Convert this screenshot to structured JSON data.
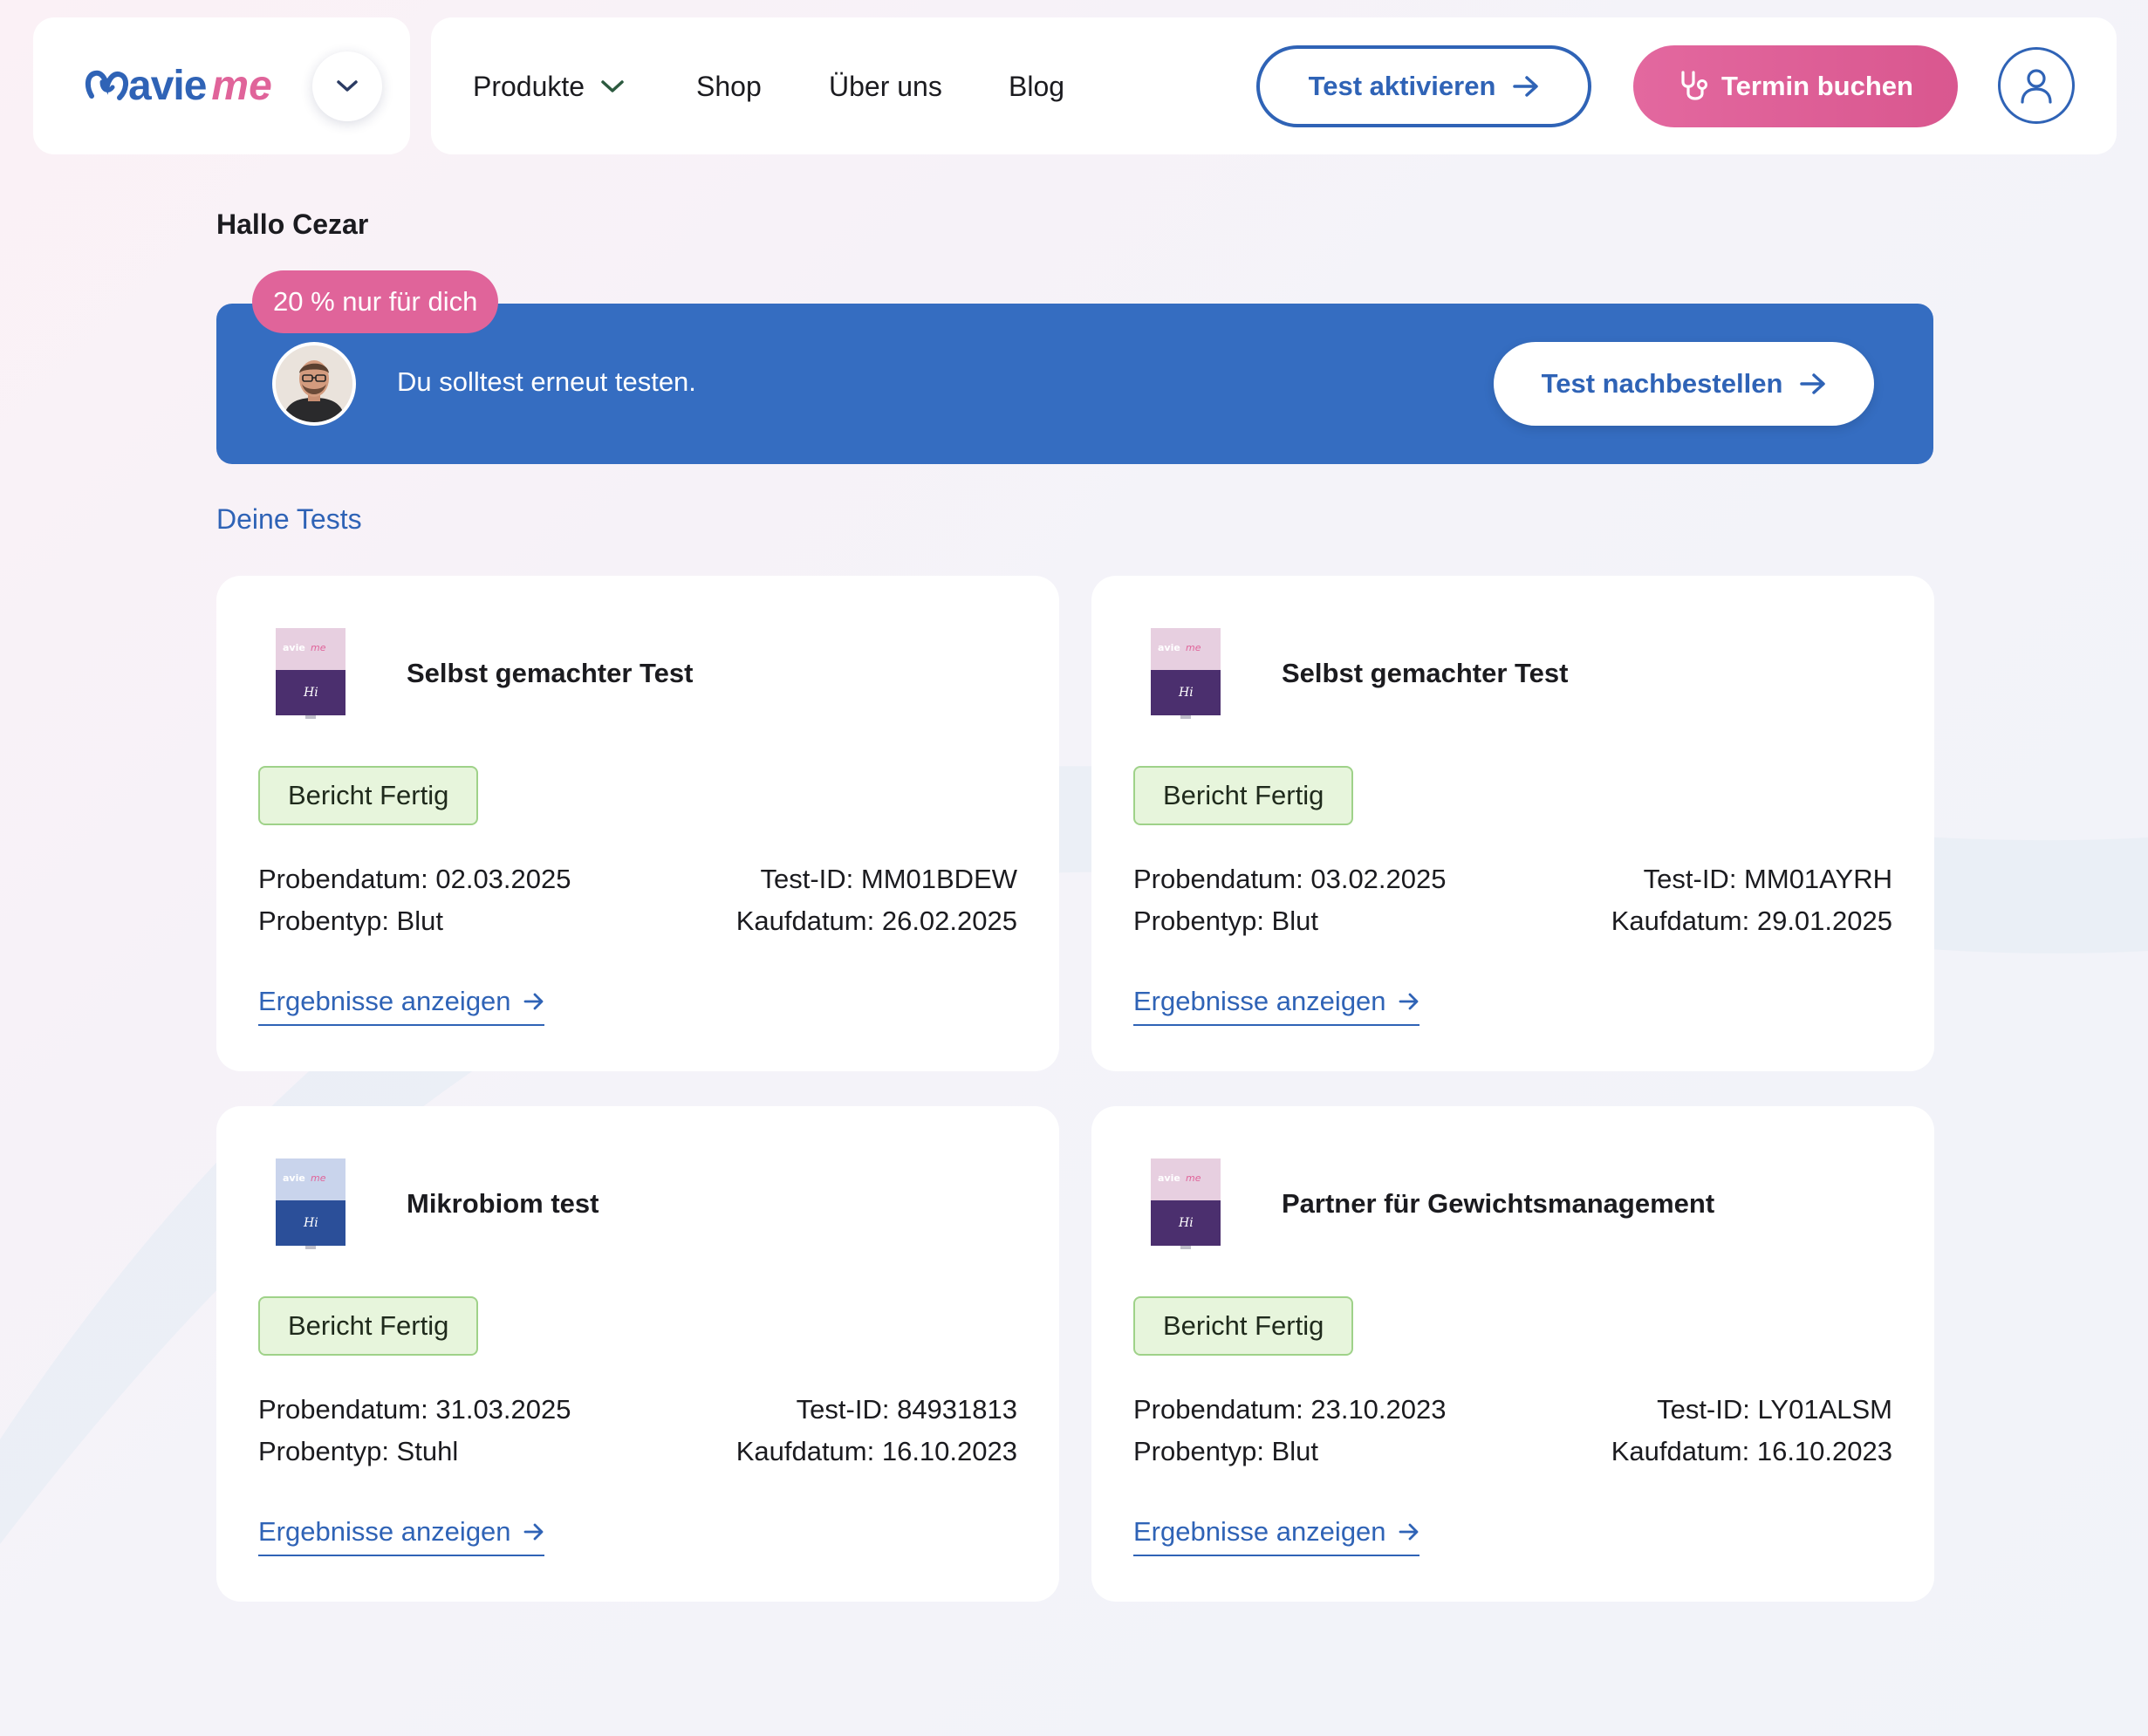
{
  "header": {
    "brand": {
      "part1": "avie",
      "part2": "me"
    },
    "nav": [
      {
        "label": "Produkte",
        "has_dropdown": true
      },
      {
        "label": "Shop"
      },
      {
        "label": "Über uns"
      },
      {
        "label": "Blog"
      }
    ],
    "activate_label": "Test aktivieren",
    "book_label": "Termin buchen"
  },
  "greeting": "Hallo Cezar",
  "promo": {
    "badge": "20 % nur für dich",
    "text": "Du solltest erneut testen.",
    "button_label": "Test nachbestellen"
  },
  "section_title": "Deine Tests",
  "tests": [
    {
      "title": "Selbst gemachter Test",
      "status": "Bericht Fertig",
      "sample_date": "Probendatum: 02.03.2025",
      "sample_type": "Probentyp: Blut",
      "test_id": "Test-ID: MM01BDEW",
      "purchase_date": "Kaufdatum: 26.02.2025",
      "link": "Ergebnisse anzeigen"
    },
    {
      "title": "Selbst gemachter Test",
      "status": "Bericht Fertig",
      "sample_date": "Probendatum: 03.02.2025",
      "sample_type": "Probentyp: Blut",
      "test_id": "Test-ID: MM01AYRH",
      "purchase_date": "Kaufdatum: 29.01.2025",
      "link": "Ergebnisse anzeigen"
    },
    {
      "title": "Mikrobiom test",
      "status": "Bericht Fertig",
      "sample_date": "Probendatum: 31.03.2025",
      "sample_type": "Probentyp: Stuhl",
      "test_id": "Test-ID: 84931813",
      "purchase_date": "Kaufdatum: 16.10.2023",
      "link": "Ergebnisse anzeigen"
    },
    {
      "title": "Partner für Gewichtsmanagement",
      "status": "Bericht Fertig",
      "sample_date": "Probendatum: 23.10.2023",
      "sample_type": "Probentyp: Blut",
      "test_id": "Test-ID: LY01ALSM",
      "purchase_date": "Kaufdatum: 16.10.2023",
      "link": "Ergebnisse anzeigen"
    }
  ],
  "colors": {
    "brand_blue": "#2f63b6",
    "brand_pink": "#e0649a",
    "promo_blue": "#356dc1",
    "status_green_bg": "#e7f5dc"
  }
}
